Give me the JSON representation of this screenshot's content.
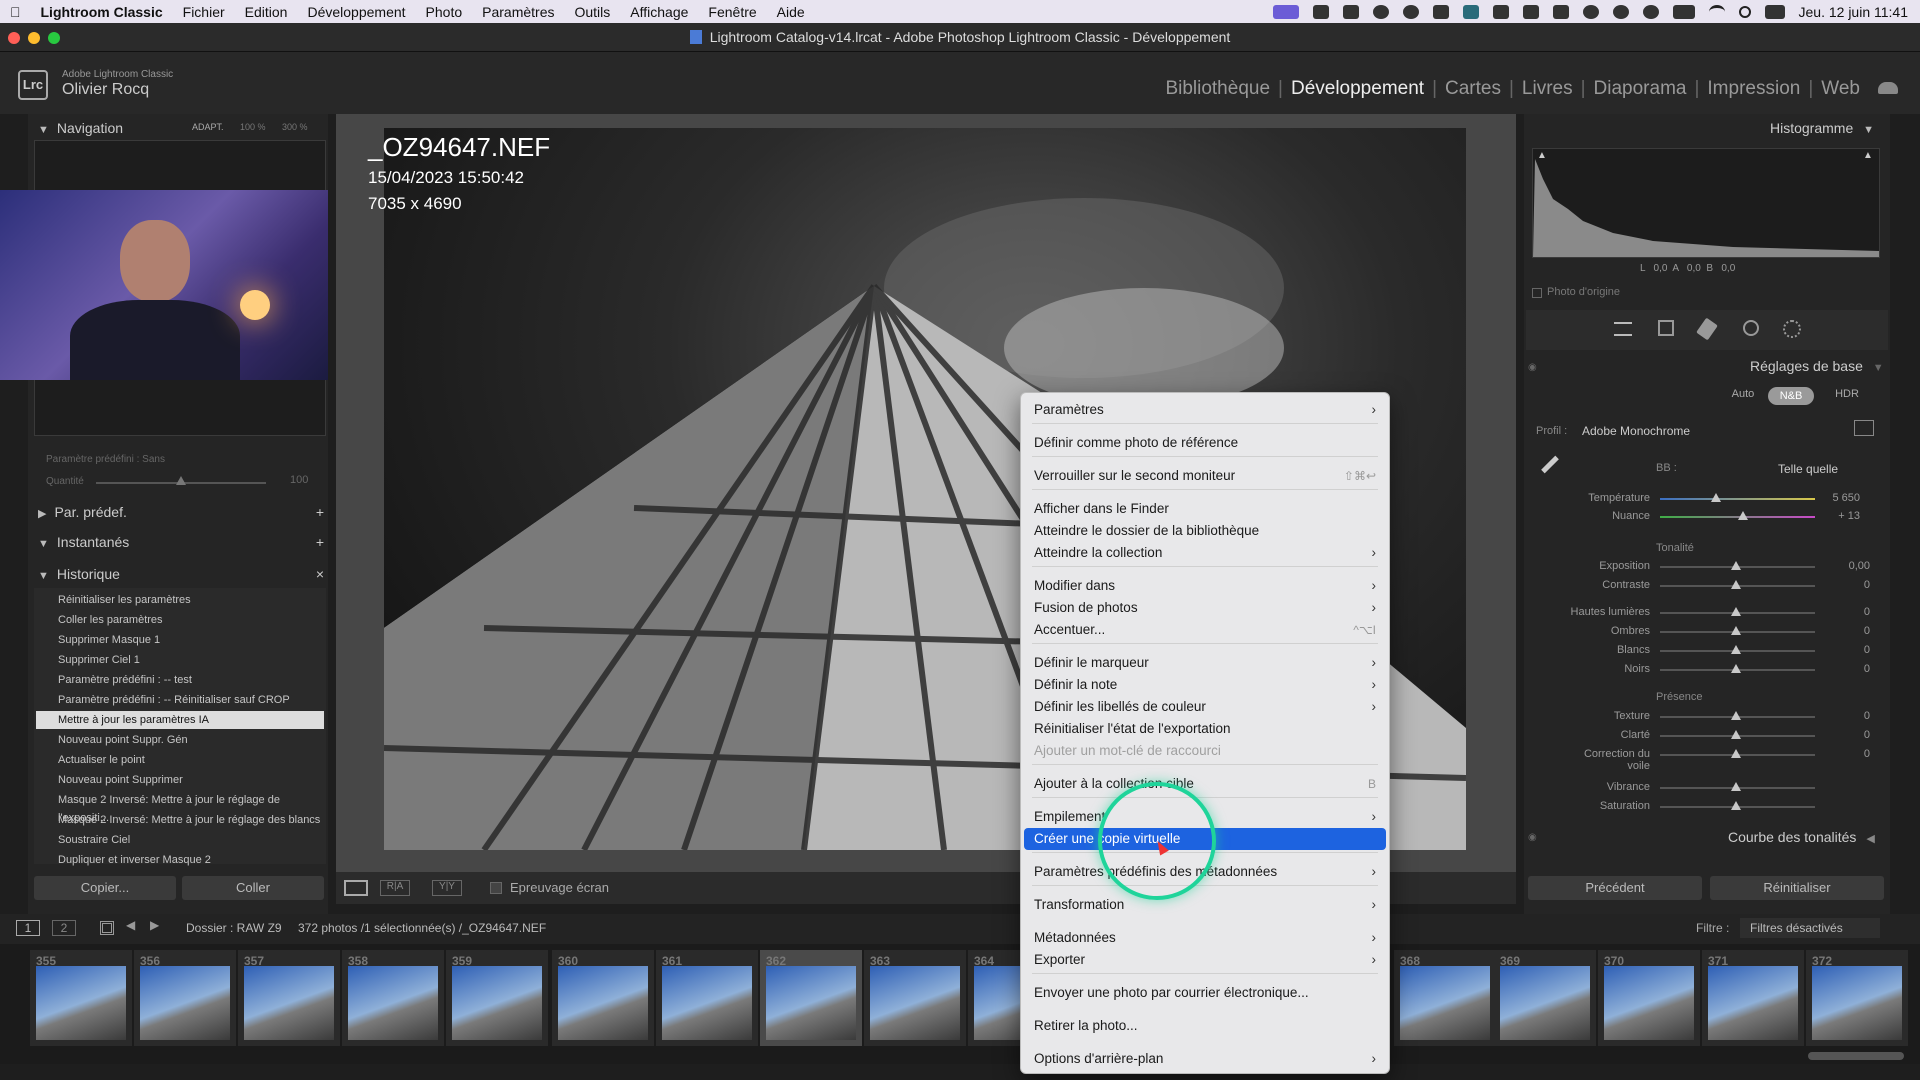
{
  "menubar": {
    "app": "Lightroom Classic",
    "items": [
      "Fichier",
      "Edition",
      "Développement",
      "Photo",
      "Paramètres",
      "Outils",
      "Affichage",
      "Fenêtre",
      "Aide"
    ],
    "clock": "Jeu. 12 juin  11:41"
  },
  "window": {
    "title": "Lightroom Catalog-v14.lrcat - Adobe Photoshop Lightroom Classic - Développement"
  },
  "header": {
    "logo": "Lrc",
    "brand": "Adobe Lightroom Classic",
    "user": "Olivier Rocq",
    "modules": [
      "Bibliothèque",
      "Développement",
      "Cartes",
      "Livres",
      "Diaporama",
      "Impression",
      "Web"
    ],
    "active_module": "Développement"
  },
  "left": {
    "navigation": {
      "title": "Navigation",
      "zoom": [
        "ADAPT.",
        "100 %",
        "300 %"
      ]
    },
    "preset_label": "Paramètre prédéfini : Sans",
    "quantity_label": "Quantité",
    "quantity_value": "100",
    "sections": {
      "presets": "Par. prédef.",
      "snapshots": "Instantanés",
      "history": "Historique"
    },
    "history": [
      "Réinitialiser les paramètres",
      "Coller les paramètres",
      "Supprimer Masque 1",
      "Supprimer Ciel 1",
      "Paramètre prédéfini : -- test",
      "Paramètre prédéfini : -- Réinitialiser sauf CROP",
      "Mettre à jour les paramètres IA",
      "Nouveau point Suppr. Gén",
      "Actualiser le point",
      "Nouveau point Supprimer",
      "Masque 2 Inversé: Mettre à jour le réglage de l'expositi...",
      "Masque 2 Inversé: Mettre à jour le réglage des blancs",
      "Soustraire Ciel",
      "Dupliquer et inverser Masque 2"
    ],
    "history_selected": 6,
    "copy_btn": "Copier...",
    "paste_btn": "Coller"
  },
  "photo": {
    "filename": "_OZ94647.NEF",
    "datetime": "15/04/2023 15:50:42",
    "dimensions": "7035 x 4690"
  },
  "toolbar": {
    "proof_label": "Epreuvage écran"
  },
  "right": {
    "histogram_title": "Histogramme",
    "hist_values": "L   0,0  A   0,0  B   0,0",
    "original_photo": "Photo d'origine",
    "basic_title": "Réglages de base",
    "modes": [
      "Auto",
      "N&B",
      "HDR"
    ],
    "active_mode": "N&B",
    "profile_label": "Profil :",
    "profile_value": "Adobe Monochrome",
    "wb_label": "BB :",
    "wb_value": "Telle quelle",
    "temp_label": "Température",
    "temp_value": "5 650",
    "tint_label": "Nuance",
    "tint_value": "+ 13",
    "tone_title": "Tonalité",
    "tone_sliders": [
      {
        "label": "Exposition",
        "value": "0,00"
      },
      {
        "label": "Contraste",
        "value": "0"
      },
      {
        "label": "Hautes lumières",
        "value": "0"
      },
      {
        "label": "Ombres",
        "value": "0"
      },
      {
        "label": "Blancs",
        "value": "0"
      },
      {
        "label": "Noirs",
        "value": "0"
      }
    ],
    "presence_title": "Présence",
    "presence_sliders": [
      {
        "label": "Texture",
        "value": "0"
      },
      {
        "label": "Clarté",
        "value": "0"
      },
      {
        "label": "Correction du voile",
        "value": "0"
      },
      {
        "label": "Vibrance",
        "value": ""
      },
      {
        "label": "Saturation",
        "value": ""
      }
    ],
    "curve_title": "Courbe des tonalités",
    "prev_btn": "Précédent",
    "reset_btn": "Réinitialiser"
  },
  "filmbar": {
    "screens": [
      "1",
      "2"
    ],
    "source_label": "Dossier : RAW Z9",
    "count_label": "372 photos /1 sélectionnée(s) /_OZ94647.NEF",
    "filter_label": "Filtre :",
    "filter_value": "Filtres désactivés"
  },
  "filmstrip": [
    "355",
    "356",
    "357",
    "358",
    "359",
    "360",
    "361",
    "362",
    "363",
    "364",
    "368",
    "369",
    "370",
    "371",
    "372"
  ],
  "context_menu": {
    "items": [
      {
        "label": "Paramètres",
        "sub": true
      },
      {
        "label": "Définir comme photo de référence"
      },
      {
        "label": "Verrouiller sur le second moniteur",
        "shortcut": "⇧⌘↩"
      },
      {
        "label": "Afficher dans le Finder"
      },
      {
        "label": "Atteindre le dossier de la bibliothèque"
      },
      {
        "label": "Atteindre la collection",
        "sub": true
      },
      {
        "label": "Modifier dans",
        "sub": true
      },
      {
        "label": "Fusion de photos",
        "sub": true
      },
      {
        "label": "Accentuer...",
        "shortcut": "^⌥I"
      },
      {
        "label": "Définir le marqueur",
        "sub": true
      },
      {
        "label": "Définir la note",
        "sub": true
      },
      {
        "label": "Définir les libellés de couleur",
        "sub": true
      },
      {
        "label": "Réinitialiser l'état de l'exportation"
      },
      {
        "label": "Ajouter un mot-clé de raccourci",
        "disabled": true
      },
      {
        "label": "Ajouter à la collection cible",
        "shortcut": "B"
      },
      {
        "label": "Empilement",
        "sub": true
      },
      {
        "label": "Créer une copie virtuelle",
        "highlighted": true
      },
      {
        "label": "Paramètres prédéfinis des métadonnées",
        "sub": true
      },
      {
        "label": "Transformation",
        "sub": true
      },
      {
        "label": "Métadonnées",
        "sub": true
      },
      {
        "label": "Exporter",
        "sub": true
      },
      {
        "label": "Envoyer une photo par courrier électronique..."
      },
      {
        "label": "Retirer la photo..."
      },
      {
        "label": "Options d'arrière-plan",
        "sub": true
      }
    ]
  },
  "colors": {
    "highlight": "#1d63e0",
    "click_ring": "#1fd49a",
    "menubar": "#e8e4f0"
  }
}
